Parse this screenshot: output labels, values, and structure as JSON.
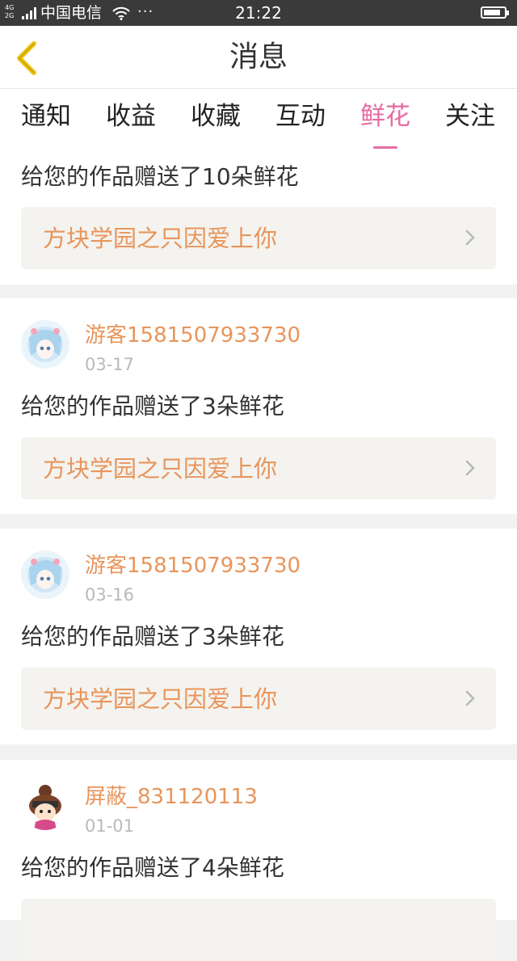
{
  "status_bar": {
    "network_top": "4G",
    "network_bottom": "2G",
    "carrier": "中国电信",
    "more": "···",
    "time": "21:22"
  },
  "header": {
    "title": "消息",
    "back_icon": "chevron-left-icon"
  },
  "tabs": [
    {
      "label": "通知",
      "active": false
    },
    {
      "label": "收益",
      "active": false
    },
    {
      "label": "收藏",
      "active": false
    },
    {
      "label": "互动",
      "active": false
    },
    {
      "label": "鲜花",
      "active": true
    },
    {
      "label": "关注",
      "active": false
    }
  ],
  "accent_color": "#e66ba0",
  "name_color": "#e8955c",
  "messages": [
    {
      "text": "给您的作品赠送了10朵鲜花",
      "work_title": "方块学园之只因爱上你"
    },
    {
      "user": "游客1581507933730",
      "date": "03-17",
      "text": "给您的作品赠送了3朵鲜花",
      "work_title": "方块学园之只因爱上你"
    },
    {
      "user": "游客1581507933730",
      "date": "03-16",
      "text": "给您的作品赠送了3朵鲜花",
      "work_title": "方块学园之只因爱上你"
    },
    {
      "user": "屏蔽_831120113",
      "date": "01-01",
      "text": "给您的作品赠送了4朵鲜花"
    }
  ]
}
